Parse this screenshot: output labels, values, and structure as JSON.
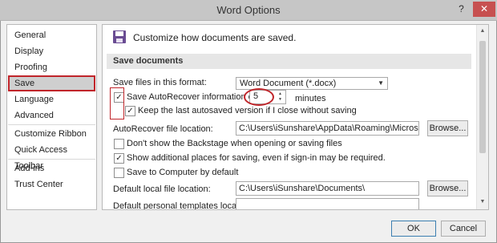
{
  "window": {
    "title": "Word Options",
    "help_label": "?",
    "close_label": "✕"
  },
  "sidebar": {
    "items": [
      {
        "label": "General"
      },
      {
        "label": "Display"
      },
      {
        "label": "Proofing"
      },
      {
        "label": "Save",
        "selected": true
      },
      {
        "label": "Language"
      },
      {
        "label": "Advanced"
      },
      {
        "label": "Customize Ribbon"
      },
      {
        "label": "Quick Access Toolbar"
      },
      {
        "label": "Add-ins"
      },
      {
        "label": "Trust Center"
      }
    ]
  },
  "main": {
    "header": "Customize how documents are saved.",
    "section_title": "Save documents",
    "format_label": "Save files in this format:",
    "format_value": "Word Document (*.docx)",
    "autorecover_label": "Save AutoRecover information every",
    "autorecover_minutes": "5",
    "minutes_label": "minutes",
    "autorecover_checked": true,
    "keep_last_label": "Keep the last autosaved version if I close without saving",
    "keep_last_checked": true,
    "ar_location_label": "AutoRecover file location:",
    "ar_location_value": "C:\\Users\\iSunshare\\AppData\\Roaming\\Microsoft\\Word\\",
    "browse_label": "Browse...",
    "backstage_label": "Don't show the Backstage when opening or saving files",
    "backstage_checked": false,
    "additional_places_label": "Show additional places for saving, even if sign-in may be required.",
    "additional_places_checked": true,
    "save_computer_label": "Save to Computer by default",
    "save_computer_checked": false,
    "default_local_label": "Default local file location:",
    "default_local_value": "C:\\Users\\iSunshare\\Documents\\",
    "default_templates_label": "Default personal templates location:",
    "default_templates_value": ""
  },
  "footer": {
    "ok_label": "OK",
    "cancel_label": "Cancel"
  },
  "colors": {
    "highlight": "#c0252a",
    "selected_bg": "#cfcfcf",
    "section_bg": "#e6e6e6"
  },
  "icons": {
    "save": "floppy-disk-icon"
  }
}
